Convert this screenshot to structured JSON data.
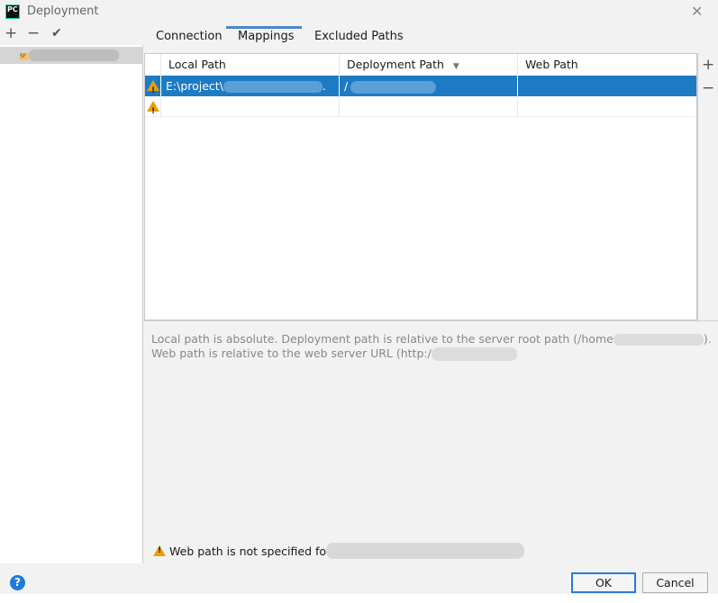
{
  "window": {
    "title": "Deployment",
    "app_icon": "PC",
    "close": "✕"
  },
  "left_toolbar": {
    "add": "+",
    "remove": "−",
    "apply": "✔"
  },
  "server_list": {
    "items": [
      {
        "icon": "SF"
      }
    ]
  },
  "tabs": [
    {
      "label": "Connection"
    },
    {
      "label": "Mappings",
      "active": true
    },
    {
      "label": "Excluded Paths"
    }
  ],
  "table": {
    "columns": [
      "Local Path",
      "Deployment Path",
      "Web Path"
    ],
    "sort_indicator": "▼",
    "rows": [
      {
        "warning": true,
        "local_path": "E:\\project\\",
        "local_path_suffix": ".",
        "deployment_path": "/",
        "web_path": "",
        "selected": true
      },
      {
        "warning": true,
        "local_path": "",
        "deployment_path": "",
        "web_path": "",
        "selected": false
      }
    ],
    "add": "+",
    "remove": "−"
  },
  "info": {
    "line1_prefix": "Local path is absolute. Deployment path is relative to the server root path (/home",
    "line1_suffix": ").",
    "line2_prefix": "Web path is relative to the web server URL (http:/"
  },
  "warning_message": "Web path is not specified for",
  "footer": {
    "help": "?",
    "ok": "OK",
    "cancel": "Cancel"
  },
  "colors": {
    "accent": "#1d7bc4",
    "warning": "#e8a000",
    "tab_underline": "#4a88c7"
  }
}
